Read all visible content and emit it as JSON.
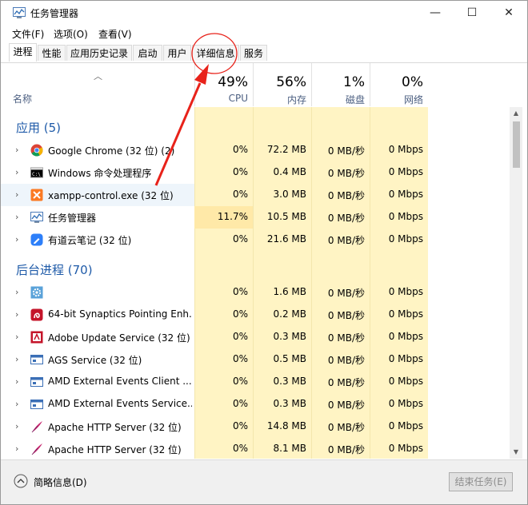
{
  "window": {
    "title": "任务管理器",
    "minimize": "—",
    "maximize": "☐",
    "close": "✕"
  },
  "menu": [
    "文件(F)",
    "选项(O)",
    "查看(V)"
  ],
  "tabs": [
    "进程",
    "性能",
    "应用历史记录",
    "启动",
    "用户",
    "详细信息",
    "服务"
  ],
  "active_tab": "进程",
  "columns": {
    "name": "名称",
    "cpu": {
      "pct": "49%",
      "label": "CPU"
    },
    "memory": {
      "pct": "56%",
      "label": "内存"
    },
    "disk": {
      "pct": "1%",
      "label": "磁盘"
    },
    "network": {
      "pct": "0%",
      "label": "网络"
    }
  },
  "groups": [
    {
      "label": "应用 (5)"
    },
    {
      "label": "后台进程 (70)"
    }
  ],
  "rows": [
    {
      "name": "Google Chrome (32 位) (2)",
      "cpu": "0%",
      "mem": "72.2 MB",
      "disk": "0 MB/秒",
      "net": "0 Mbps",
      "icon": "chrome-icon",
      "cpu_highlight": false
    },
    {
      "name": "Windows 命令处理程序",
      "cpu": "0%",
      "mem": "0.4 MB",
      "disk": "0 MB/秒",
      "net": "0 Mbps",
      "icon": "cmd-icon",
      "cpu_highlight": false
    },
    {
      "name": "xampp-control.exe (32 位)",
      "cpu": "0%",
      "mem": "3.0 MB",
      "disk": "0 MB/秒",
      "net": "0 Mbps",
      "icon": "xampp-icon",
      "cpu_highlight": false
    },
    {
      "name": "任务管理器",
      "cpu": "11.7%",
      "mem": "10.5 MB",
      "disk": "0 MB/秒",
      "net": "0 Mbps",
      "icon": "task-manager-icon",
      "cpu_highlight": true
    },
    {
      "name": "有道云笔记 (32 位)",
      "cpu": "0%",
      "mem": "21.6 MB",
      "disk": "0 MB/秒",
      "net": "0 Mbps",
      "icon": "youdao-note-icon",
      "cpu_highlight": false
    },
    {
      "name": "",
      "cpu": "0%",
      "mem": "1.6 MB",
      "disk": "0 MB/秒",
      "net": "0 Mbps",
      "icon": "gear-icon",
      "cpu_highlight": false
    },
    {
      "name": "64-bit Synaptics Pointing Enh...",
      "cpu": "0%",
      "mem": "0.2 MB",
      "disk": "0 MB/秒",
      "net": "0 Mbps",
      "icon": "synaptics-icon",
      "cpu_highlight": false
    },
    {
      "name": "Adobe Update Service (32 位)",
      "cpu": "0%",
      "mem": "0.3 MB",
      "disk": "0 MB/秒",
      "net": "0 Mbps",
      "icon": "adobe-icon",
      "cpu_highlight": false
    },
    {
      "name": "AGS Service (32 位)",
      "cpu": "0%",
      "mem": "0.5 MB",
      "disk": "0 MB/秒",
      "net": "0 Mbps",
      "icon": "service-window-icon",
      "cpu_highlight": false
    },
    {
      "name": "AMD External Events Client ...",
      "cpu": "0%",
      "mem": "0.3 MB",
      "disk": "0 MB/秒",
      "net": "0 Mbps",
      "icon": "service-window-icon",
      "cpu_highlight": false
    },
    {
      "name": "AMD External Events Service...",
      "cpu": "0%",
      "mem": "0.3 MB",
      "disk": "0 MB/秒",
      "net": "0 Mbps",
      "icon": "service-window-icon",
      "cpu_highlight": false
    },
    {
      "name": "Apache HTTP Server (32 位)",
      "cpu": "0%",
      "mem": "14.8 MB",
      "disk": "0 MB/秒",
      "net": "0 Mbps",
      "icon": "apache-feather-icon",
      "cpu_highlight": false
    },
    {
      "name": "Apache HTTP Server (32 位)",
      "cpu": "0%",
      "mem": "8.1 MB",
      "disk": "0 MB/秒",
      "net": "0 Mbps",
      "icon": "apache-feather-icon",
      "cpu_highlight": false
    }
  ],
  "footer": {
    "fewer_details": "简略信息(D)",
    "end_task": "结束任务(E)"
  },
  "colors": {
    "highlight_column": "#fff4c4",
    "cpu_hot": "#ffe9a8",
    "group_text": "#1e5aa8",
    "arrow": "#e8221a"
  }
}
